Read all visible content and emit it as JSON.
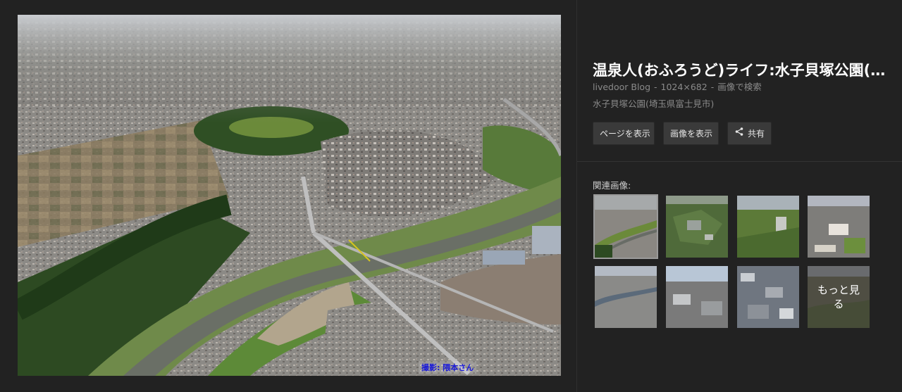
{
  "preview": {
    "photo_credit": "撮影: 隈本さん"
  },
  "info": {
    "title": "温泉人(おふろうど)ライフ:水子貝塚公園(埼玉県富士見市)",
    "source": "livedoor Blog",
    "dimensions": "1024×682",
    "search_by_image": "画像で検索",
    "separator": "-",
    "caption": "水子貝塚公園(埼玉県富士見市)"
  },
  "buttons": {
    "view_page": "ページを表示",
    "view_image": "画像を表示",
    "share": "共有"
  },
  "related": {
    "label": "関連画像:",
    "more_line1": "もっと見",
    "more_line2": "る"
  },
  "icons": {
    "share": "share-icon"
  },
  "colors": {
    "background": "#222222",
    "button": "#3a3a3a",
    "meta_text": "#8a8a8a",
    "credit_text": "#1a1ad8"
  }
}
